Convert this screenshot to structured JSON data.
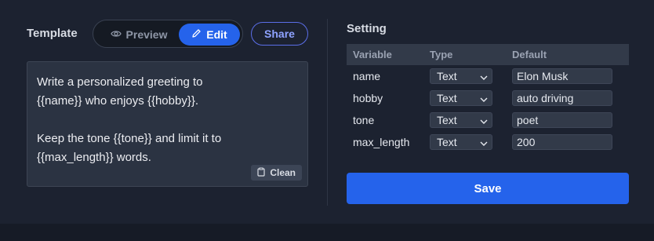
{
  "template": {
    "label": "Template",
    "modes": {
      "preview_label": "Preview",
      "edit_label": "Edit",
      "active": "Edit"
    },
    "share_label": "Share",
    "text": "Write a personalized greeting to\n{{name}} who enjoys {{hobby}}.\n\nKeep the tone {{tone}} and limit it to\n{{max_length}} words.",
    "clean_label": "Clean"
  },
  "setting": {
    "label": "Setting",
    "columns": [
      "Variable",
      "Type",
      "Default"
    ],
    "rows": [
      {
        "variable": "name",
        "type": "Text",
        "default": "Elon Musk"
      },
      {
        "variable": "hobby",
        "type": "Text",
        "default": "auto driving"
      },
      {
        "variable": "tone",
        "type": "Text",
        "default": "poet"
      },
      {
        "variable": "max_length",
        "type": "Text",
        "default": "200"
      }
    ],
    "save_label": "Save"
  },
  "colors": {
    "background": "#1c2230",
    "accent": "#2563eb",
    "panel": "#2b3342",
    "share_border": "#5b6ee8"
  },
  "icons": {
    "preview": "eye-icon",
    "edit": "pencil-icon",
    "clean": "clipboard-icon",
    "select": "chevron-down-icon"
  }
}
